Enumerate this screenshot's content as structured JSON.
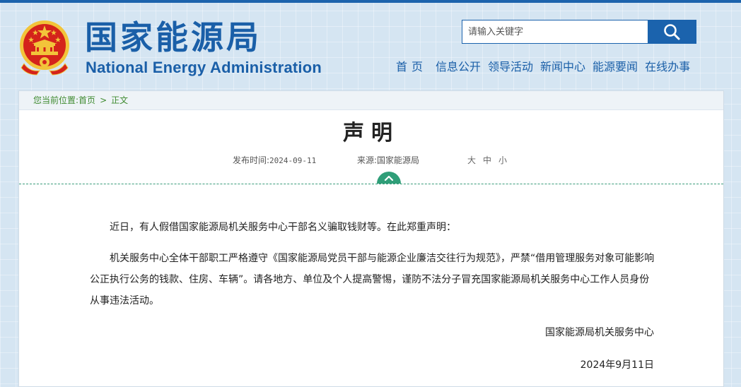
{
  "header": {
    "logo_cn": "国家能源局",
    "logo_en": "National Energy Administration",
    "emblem_icon": "national-emblem-icon",
    "search": {
      "placeholder": "请输入关键字",
      "button_icon": "search-icon"
    },
    "nav": [
      "首页",
      "信息公开",
      "领导活动",
      "新闻中心",
      "能源要闻",
      "在线办事"
    ]
  },
  "breadcrumb": {
    "label": "您当前位置:",
    "home": "首页",
    "separator": ">",
    "current": "正文"
  },
  "article": {
    "title": "声明",
    "publish_label": "发布时间:",
    "publish_date": "2024-09-11",
    "source_label": "来源:",
    "source": "国家能源局",
    "font_sizes": [
      "大",
      "中",
      "小"
    ],
    "paragraphs": [
      "近日，有人假借国家能源局机关服务中心干部名义骗取钱财等。在此郑重声明：",
      "机关服务中心全体干部职工严格遵守《国家能源局党员干部与能源企业廉洁交往行为规范》，严禁“借用管理服务对象可能影响公正执行公务的钱款、住房、车辆”。请各地方、单位及个人提高警惕，谨防不法分子冒充国家能源局机关服务中心工作人员身份从事违法活动。"
    ],
    "signature": "国家能源局机关服务中心",
    "sign_date": "2024年9月11日"
  },
  "colors": {
    "brand_blue": "#1a5fa8",
    "breadcrumb_green": "#3e8a2f",
    "accent_teal": "#2f9e78",
    "emblem_red": "#d4231b",
    "emblem_gold": "#f2c43a"
  }
}
